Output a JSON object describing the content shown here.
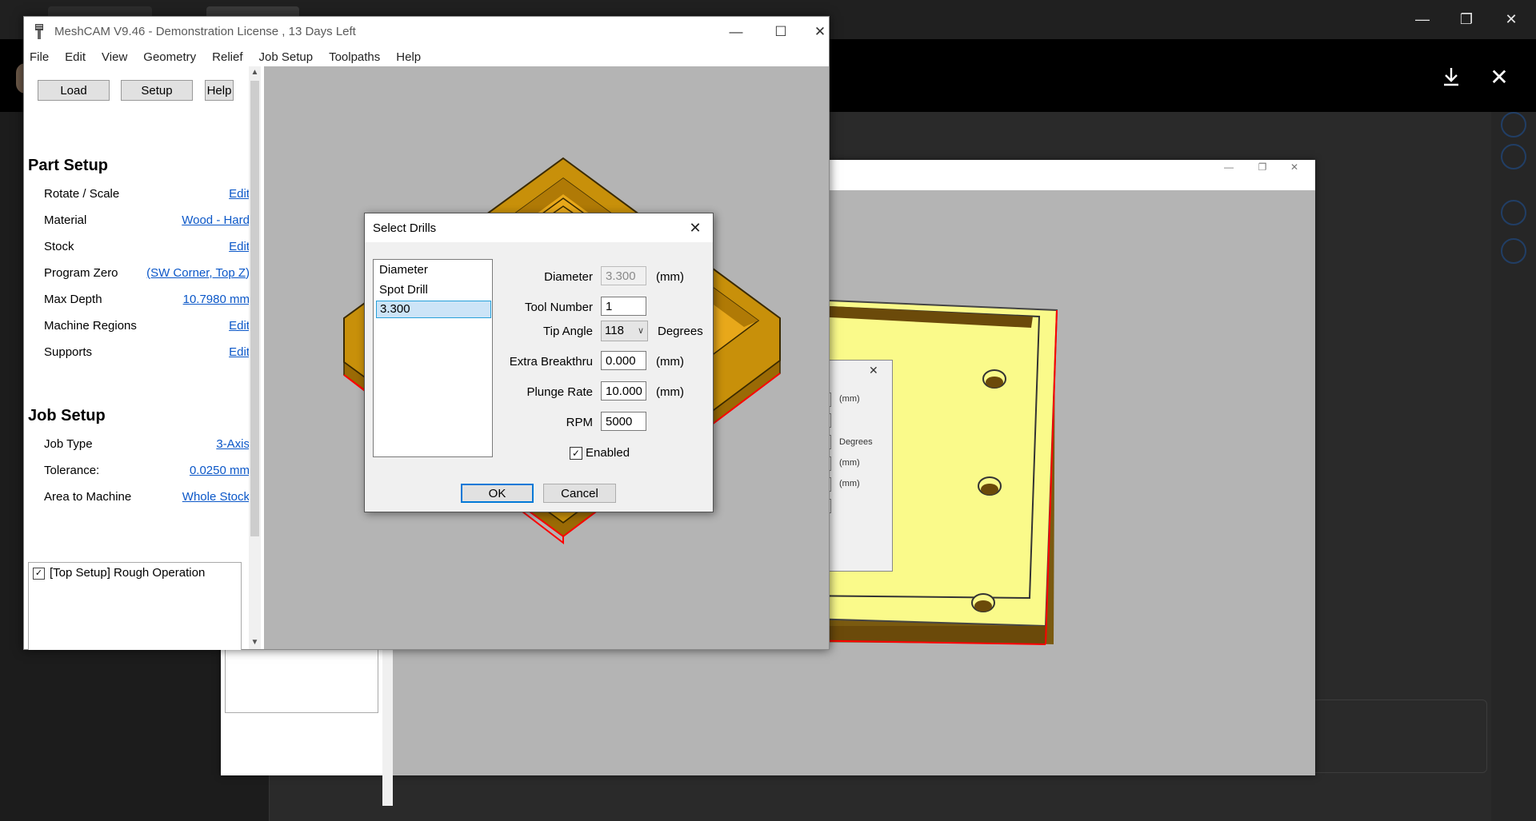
{
  "background": {
    "viewer_controls": [
      "minimize-icon",
      "restore-icon",
      "close-icon"
    ],
    "viewer_actions": [
      "download-icon",
      "close-icon"
    ]
  },
  "window": {
    "title": "MeshCAM V9.46 - Demonstration License  , 13 Days Left",
    "menu": [
      "File",
      "Edit",
      "View",
      "Geometry",
      "Relief",
      "Job Setup",
      "Toolpaths",
      "Help"
    ]
  },
  "panel": {
    "buttons": {
      "load": "Load",
      "setup": "Setup",
      "help": "Help"
    },
    "part_setup": {
      "title": "Part Setup",
      "rows": [
        {
          "label": "Rotate / Scale",
          "value": "Edit"
        },
        {
          "label": "Material",
          "value": "Wood - Hard"
        },
        {
          "label": "Stock",
          "value": "Edit"
        },
        {
          "label": "Program Zero",
          "value": "(SW Corner, Top Z)"
        },
        {
          "label": "Max Depth",
          "value": "10.7980 mm"
        },
        {
          "label": "Machine Regions",
          "value": "Edit"
        },
        {
          "label": "Supports",
          "value": "Edit"
        }
      ]
    },
    "job_setup": {
      "title": "Job Setup",
      "rows": [
        {
          "label": "Job Type",
          "value": "3-Axis"
        },
        {
          "label": "Tolerance:",
          "value": "0.0250 mm"
        },
        {
          "label": "Area to Machine",
          "value": "Whole Stock"
        }
      ]
    },
    "operations": [
      {
        "checked": true,
        "text": "[Top Setup]   Rough Operation"
      }
    ]
  },
  "ghost_dialog": {
    "units": [
      "(mm)",
      "Degrees",
      "(mm)",
      "(mm)"
    ],
    "values": [
      "00",
      "00",
      "000",
      "00"
    ]
  },
  "dialog": {
    "title": "Select Drills",
    "list": [
      "Diameter",
      "Spot Drill",
      "3.300"
    ],
    "selected_index": 2,
    "fields": {
      "diameter": {
        "label": "Diameter",
        "value": "3.300",
        "unit": "(mm)"
      },
      "tool_number": {
        "label": "Tool Number",
        "value": "1"
      },
      "tip_angle": {
        "label": "Tip Angle",
        "value": "118",
        "unit": "Degrees"
      },
      "extra_breakthru": {
        "label": "Extra Breakthru",
        "value": "0.000",
        "unit": "(mm)"
      },
      "plunge_rate": {
        "label": "Plunge Rate",
        "value": "10.000",
        "unit": "(mm)"
      },
      "rpm": {
        "label": "RPM",
        "value": "5000"
      }
    },
    "enabled": {
      "label": "Enabled",
      "checked": true
    },
    "ok": "OK",
    "cancel": "Cancel"
  },
  "colors": {
    "model_wood": "#c8900a",
    "model_yellow": "#fafa8a",
    "viewport_bg": "#b4b4b4",
    "link": "#0b57c8",
    "stock_edge": "#ff0000"
  }
}
